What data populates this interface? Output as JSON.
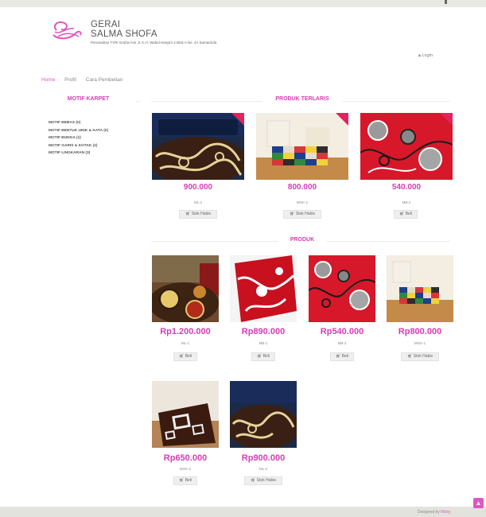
{
  "brand": {
    "line1": "GERAI",
    "line2": "SALMA SHOFA",
    "address": "Perumahan TVRI Graha Asri Jl. K.H. Wahid Hasyim 2 Blok A No. 4A Samarinda"
  },
  "login": "Login",
  "nav": {
    "home": "Home",
    "profil": "Profil",
    "cara": "Cara Pembelian"
  },
  "sidebar": {
    "title": "MOTIF KARPET",
    "items": [
      "MOTIF BEBAS (0)",
      "MOTIF BENTUK UNIK & KATA (0)",
      "MOTIF BUNGA (1)",
      "MOTIF GARIS & KOTAK (2)",
      "MOTIF LINGKARAN (3)"
    ]
  },
  "terlaris": {
    "title": "PRODUK TERLARIS",
    "items": [
      {
        "price": "900.000",
        "code": "ML-2",
        "button": "Stok Habis",
        "image": "swirl-brown"
      },
      {
        "price": "800.000",
        "code": "MGK-1",
        "button": "Stok Habis",
        "image": "checker-room"
      },
      {
        "price": "540.000",
        "code": "MB-2",
        "button": "Beli",
        "image": "red-floral"
      }
    ]
  },
  "produk": {
    "title": "PRODUK",
    "items": [
      {
        "price": "Rp1.200.000",
        "code": "ML-1",
        "button": "Beli",
        "image": "brown-circles"
      },
      {
        "price": "Rp890.000",
        "code": "MB-1",
        "button": "Beli",
        "image": "red-white-floral"
      },
      {
        "price": "Rp540.000",
        "code": "MB-2",
        "button": "Beli",
        "image": "red-floral"
      },
      {
        "price": "Rp800.000",
        "code": "MGK-1",
        "button": "Stok Habis",
        "image": "checker-room"
      },
      {
        "price": "Rp650.000",
        "code": "MGK-2",
        "button": "Beli",
        "image": "brown-squares"
      },
      {
        "price": "Rp900.000",
        "code": "ML-2",
        "button": "Stok Habis",
        "image": "swirl-brown"
      }
    ]
  },
  "footer": {
    "text": "Designed by",
    "author": "Ricky"
  },
  "colors": {
    "accent": "#d63cb6",
    "footer": "#e3e3de"
  }
}
